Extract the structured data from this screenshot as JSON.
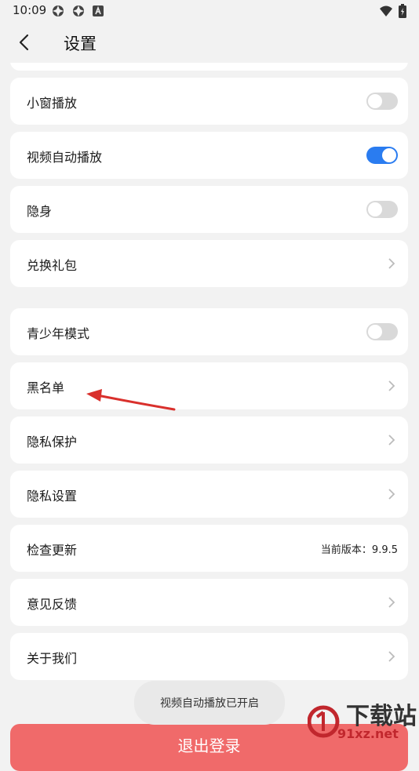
{
  "status_bar": {
    "time": "10:09"
  },
  "header": {
    "title": "设置"
  },
  "items": [
    {
      "label": "小窗播放",
      "kind": "toggle",
      "on": false
    },
    {
      "label": "视频自动播放",
      "kind": "toggle",
      "on": true
    },
    {
      "label": "隐身",
      "kind": "toggle",
      "on": false
    },
    {
      "label": "兑换礼包",
      "kind": "link"
    },
    {
      "label": "青少年模式",
      "kind": "toggle",
      "on": false
    },
    {
      "label": "黑名单",
      "kind": "link"
    },
    {
      "label": "隐私保护",
      "kind": "link"
    },
    {
      "label": "隐私设置",
      "kind": "link"
    },
    {
      "label": "检查更新",
      "kind": "value",
      "value": "当前版本：9.9.5"
    },
    {
      "label": "意见反馈",
      "kind": "link"
    },
    {
      "label": "关于我们",
      "kind": "link"
    }
  ],
  "toast": {
    "text": "视频自动播放已开启"
  },
  "logout": {
    "label": "退出登录"
  },
  "watermark": {
    "line1": "下载站",
    "line2": "91xz.net"
  },
  "colors": {
    "accent": "#2a7cf0",
    "logout": "#f06a6a",
    "annotation_arrow": "#d9302c"
  }
}
